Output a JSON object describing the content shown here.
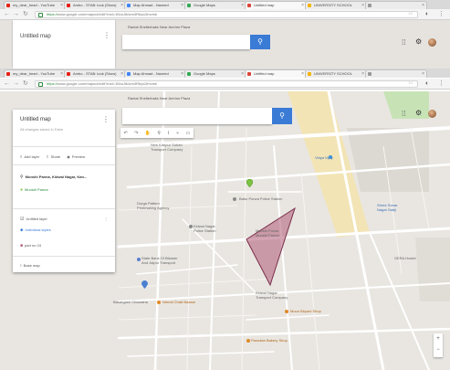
{
  "browser_top": {
    "tabs": [
      {
        "label": "my_dear_heart - YouTube",
        "fav": "#e62117",
        "active": false
      },
      {
        "label": "Ambo - STAB: look (Show)",
        "fav": "#e62117",
        "active": false
      },
      {
        "label": "Map Ahmad - Naveed",
        "fav": "#4285f4",
        "active": false
      },
      {
        "label": "Google Maps",
        "fav": "#34a853",
        "active": false
      },
      {
        "label": "Untitled map",
        "fav": "#db4437",
        "active": true
      },
      {
        "label": "UNIVERSITY SCHOOL",
        "fav": "#f4b400",
        "active": false
      },
      {
        "label": "",
        "fav": "#999999",
        "active": false
      }
    ],
    "url_scheme": "https://",
    "url_rest": "www.google.com/maps/d/edit?mid=1BvuJ8dvm3RbydJlmvmk"
  },
  "browser_main": {
    "tabs": [
      {
        "label": "my_dear_heart - YouTube",
        "fav": "#e62117",
        "active": false
      },
      {
        "label": "Ambo - STAB: look (Show)",
        "fav": "#e62117",
        "active": false
      },
      {
        "label": "Map Ahmad - Naveed",
        "fav": "#4285f4",
        "active": false
      },
      {
        "label": "Google Maps",
        "fav": "#34a853",
        "active": false
      },
      {
        "label": "Untitled map",
        "fav": "#db4437",
        "active": true
      },
      {
        "label": "UNIVERSITY SCHOOL",
        "fav": "#f4b400",
        "active": false
      },
      {
        "label": "",
        "fav": "#999999",
        "active": false
      }
    ],
    "url_scheme": "https://",
    "url_rest": "www.google.com/maps/d/edit?mid=1BvuJ8dvm3RbydJlmvmk"
  },
  "top_page": {
    "map_title": "Untitled map",
    "street_label": "Cattle Colony",
    "search_hint": "Rantai Shelterbaks Near Amrinn Plaza"
  },
  "main": {
    "panel": {
      "title": "Untitled map",
      "subtitle": "All changes saved in Drive",
      "actions": [
        {
          "icon": "add-layer-icon",
          "glyph": "≡",
          "label": "Add layer"
        },
        {
          "icon": "share-icon",
          "glyph": "⇪",
          "label": "Share"
        },
        {
          "icon": "preview-icon",
          "glyph": "◉",
          "label": "Preview"
        }
      ],
      "search_result": "Munshi Panna, Kidwai Nagar, Kan...",
      "result_item": "Munshi Panna",
      "layer_title": "Untitled layer",
      "layer_style": "Individual styles",
      "layer_item": "part no 24",
      "base_map": "Base map"
    },
    "search_hint": "Rantai Shelterbaks Near Amrinn Plaza",
    "toolbar_icons": [
      {
        "name": "undo-icon",
        "glyph": "↶"
      },
      {
        "name": "redo-icon",
        "glyph": "↷"
      },
      {
        "name": "hand-icon",
        "glyph": "✋"
      },
      {
        "name": "marker-icon",
        "glyph": "⚲"
      },
      {
        "name": "line-icon",
        "glyph": "⌇"
      },
      {
        "name": "route-icon",
        "glyph": "⑂"
      },
      {
        "name": "ruler-icon",
        "glyph": "▭"
      }
    ],
    "map_labels": {
      "transport": "New Kanpur Sohan\nTransport Company",
      "vidya": "Vidya Vijay",
      "police": "Babu Purwa Police Station",
      "printing": "Durga Pattern\nPrintmaking Agency",
      "kidwai_school": "Kidwai Nagar\nPolice Station",
      "bakers": "State Bank Of Bikaner\nAnd Jaipur Transport",
      "munshi": "Munshi Purwa\nMunshi Panna",
      "kidwai_transport": "Kidwai Nagar\nTransport Company",
      "sonar": "Shree Sonar\nNagar Sabji",
      "oera": "OERA Hostel",
      "barrageh": "Basargash Chauraha",
      "nirmal": "Nirmal Chatt Bazaar",
      "moon": "Moon Biryani Shop",
      "paradise": "Paradise Bakery Shop"
    }
  },
  "colors": {
    "polygon_fill": "#b05a78",
    "polygon_stroke": "#7a2f4c",
    "marker_green": "#7cc242",
    "accent_blue": "#3a7bd5"
  }
}
